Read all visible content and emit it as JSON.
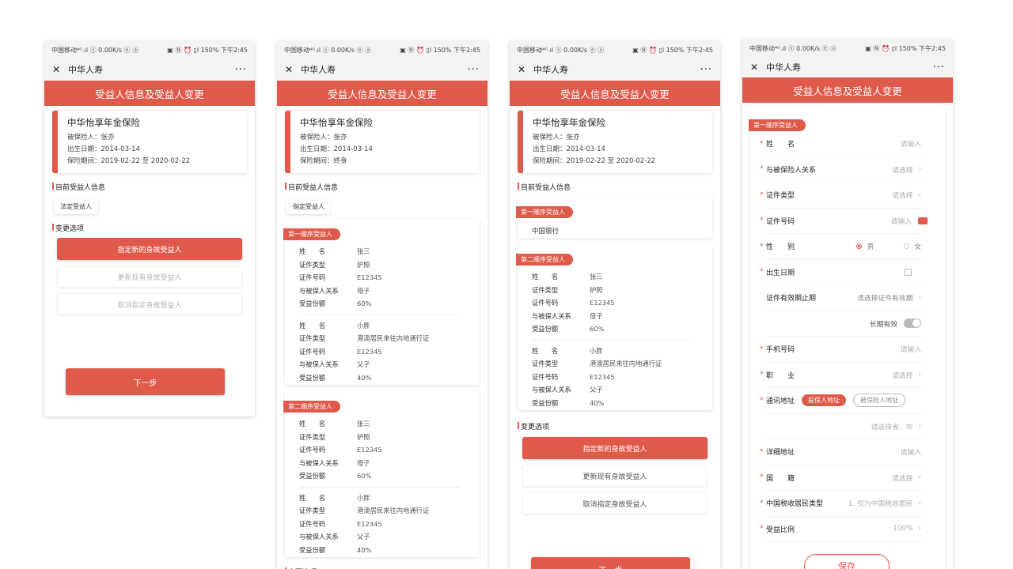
{
  "status": {
    "left": "中国移动⁴ᴳ.ıl ⓢ 0.00K/s ⓔ ⓐ",
    "right": "▣ Ⓝ ⏰ ▯l 150% 下午2:45"
  },
  "app": {
    "title": "中华人寿",
    "close_icon": "close-icon",
    "more_icon": "more-icon",
    "more": "···"
  },
  "header": {
    "title": "受益人信息及受益人变更"
  },
  "policy": {
    "name": "中华怡享年金保险",
    "insured": "被保险人：张亦",
    "birth": "出生日期：2014-03-14",
    "period_range": "保险期间：2019-02-22 至 2020-02-22",
    "period_life": "保险期间：终身"
  },
  "labels": {
    "current_beneficiary": "目前受益人信息",
    "change_options": "变更选项",
    "legal_beneficiary": "法定受益人",
    "specified_beneficiary": "指定受益人",
    "first_order": "第一顺序受益人",
    "second_order": "第二顺序受益人",
    "bank": "中国银行",
    "next": "下一步",
    "save": "保存"
  },
  "options": [
    "指定新的身故受益人",
    "更新现有身故受益人",
    "取消指定身故受益人"
  ],
  "beneficiary_keys": [
    "姓　　名",
    "证件类型",
    "证件号码",
    "与被保人关系",
    "受益份额"
  ],
  "beneficiary_a": [
    "张三",
    "护照",
    "E12345",
    "母子",
    "60%"
  ],
  "beneficiary_b": [
    "小胖",
    "港澳居民来往内地通行证",
    "E12345",
    "父子",
    "40%"
  ],
  "form": {
    "section": "第一顺序受益人",
    "name_label": "姓　　名",
    "name_ph": "请输入",
    "relation_label": "与被保险人关系",
    "relation_ph": "请选择",
    "idtype_label": "证件类型",
    "idtype_ph": "请选择",
    "idno_label": "证件号码",
    "idno_ph": "请输入",
    "gender_label": "性　　别",
    "male": "男",
    "female": "女",
    "birth_label": "出生日期",
    "validity_label": "证件有效期止期",
    "validity_ph": "请选择证件有效期",
    "long_term": "长期有效",
    "phone_label": "手机号码",
    "phone_ph": "请输入",
    "job_label": "职　　业",
    "job_ph": "请选择",
    "addr_label": "通讯地址",
    "addr_opt1": "投保人地址",
    "addr_opt2": "被保险人地址",
    "region_ph": "请选择省、市",
    "detail_label": "详细地址",
    "detail_ph": "请输入",
    "nation_label": "国　　籍",
    "nation_ph": "请选择",
    "tax_label": "中国税收居民类型",
    "tax_value": "1. 仅为中国税收居民",
    "ratio_label": "受益比例",
    "ratio_value": "100%"
  },
  "colors": {
    "accent": "#e05a4b"
  }
}
